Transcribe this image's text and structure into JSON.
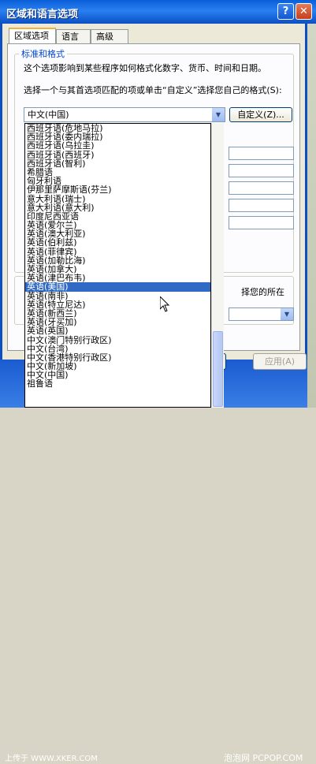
{
  "window": {
    "title": "区域和语言选项",
    "help": "?",
    "close": "✕"
  },
  "tabs": [
    {
      "label": "区域选项"
    },
    {
      "label": "语言"
    },
    {
      "label": "高级"
    }
  ],
  "standards": {
    "group_title": "标准和格式",
    "description": "这个选项影响到某些程序如何格式化数字、货币、时间和日期。",
    "select_label": "选择一个与其首选项匹配的项或单击“自定义”选择您自己的格式(S):",
    "selected_value": "中文(中国)",
    "customize_button": "自定义(Z)..."
  },
  "location": {
    "hint": "择您的所在"
  },
  "buttons": {
    "apply": "应用(A)"
  },
  "dropdown": {
    "items": [
      "西班牙语(危地马拉)",
      "西班牙语(委内瑞拉)",
      "西班牙语(乌拉圭)",
      "西班牙语(西班牙)",
      "西班牙语(智利)",
      "希腊语",
      "匈牙利语",
      "伊那里萨摩斯语(芬兰)",
      "意大利语(瑞士)",
      "意大利语(意大利)",
      "印度尼西亚语",
      "英语(爱尔兰)",
      "英语(澳大利亚)",
      "英语(伯利兹)",
      "英语(菲律宾)",
      "英语(加勒比海)",
      "英语(加拿大)",
      "英语(津巴布韦)",
      "英语(美国)",
      "英语(南非)",
      "英语(特立尼达)",
      "英语(新西兰)",
      "英语(牙买加)",
      "英语(英国)",
      "中文(澳门特别行政区)",
      "中文(台湾)",
      "中文(香港特别行政区)",
      "中文(新加坡)",
      "中文(中国)",
      "祖鲁语"
    ],
    "selected_index": 18
  },
  "watermarks": {
    "left": "上传于 WWW.XKER.COM",
    "right": "泡泡网 PCPOP.COM"
  },
  "colors": {
    "titlebar": "#0a5fd8",
    "selection": "#316ac5"
  }
}
